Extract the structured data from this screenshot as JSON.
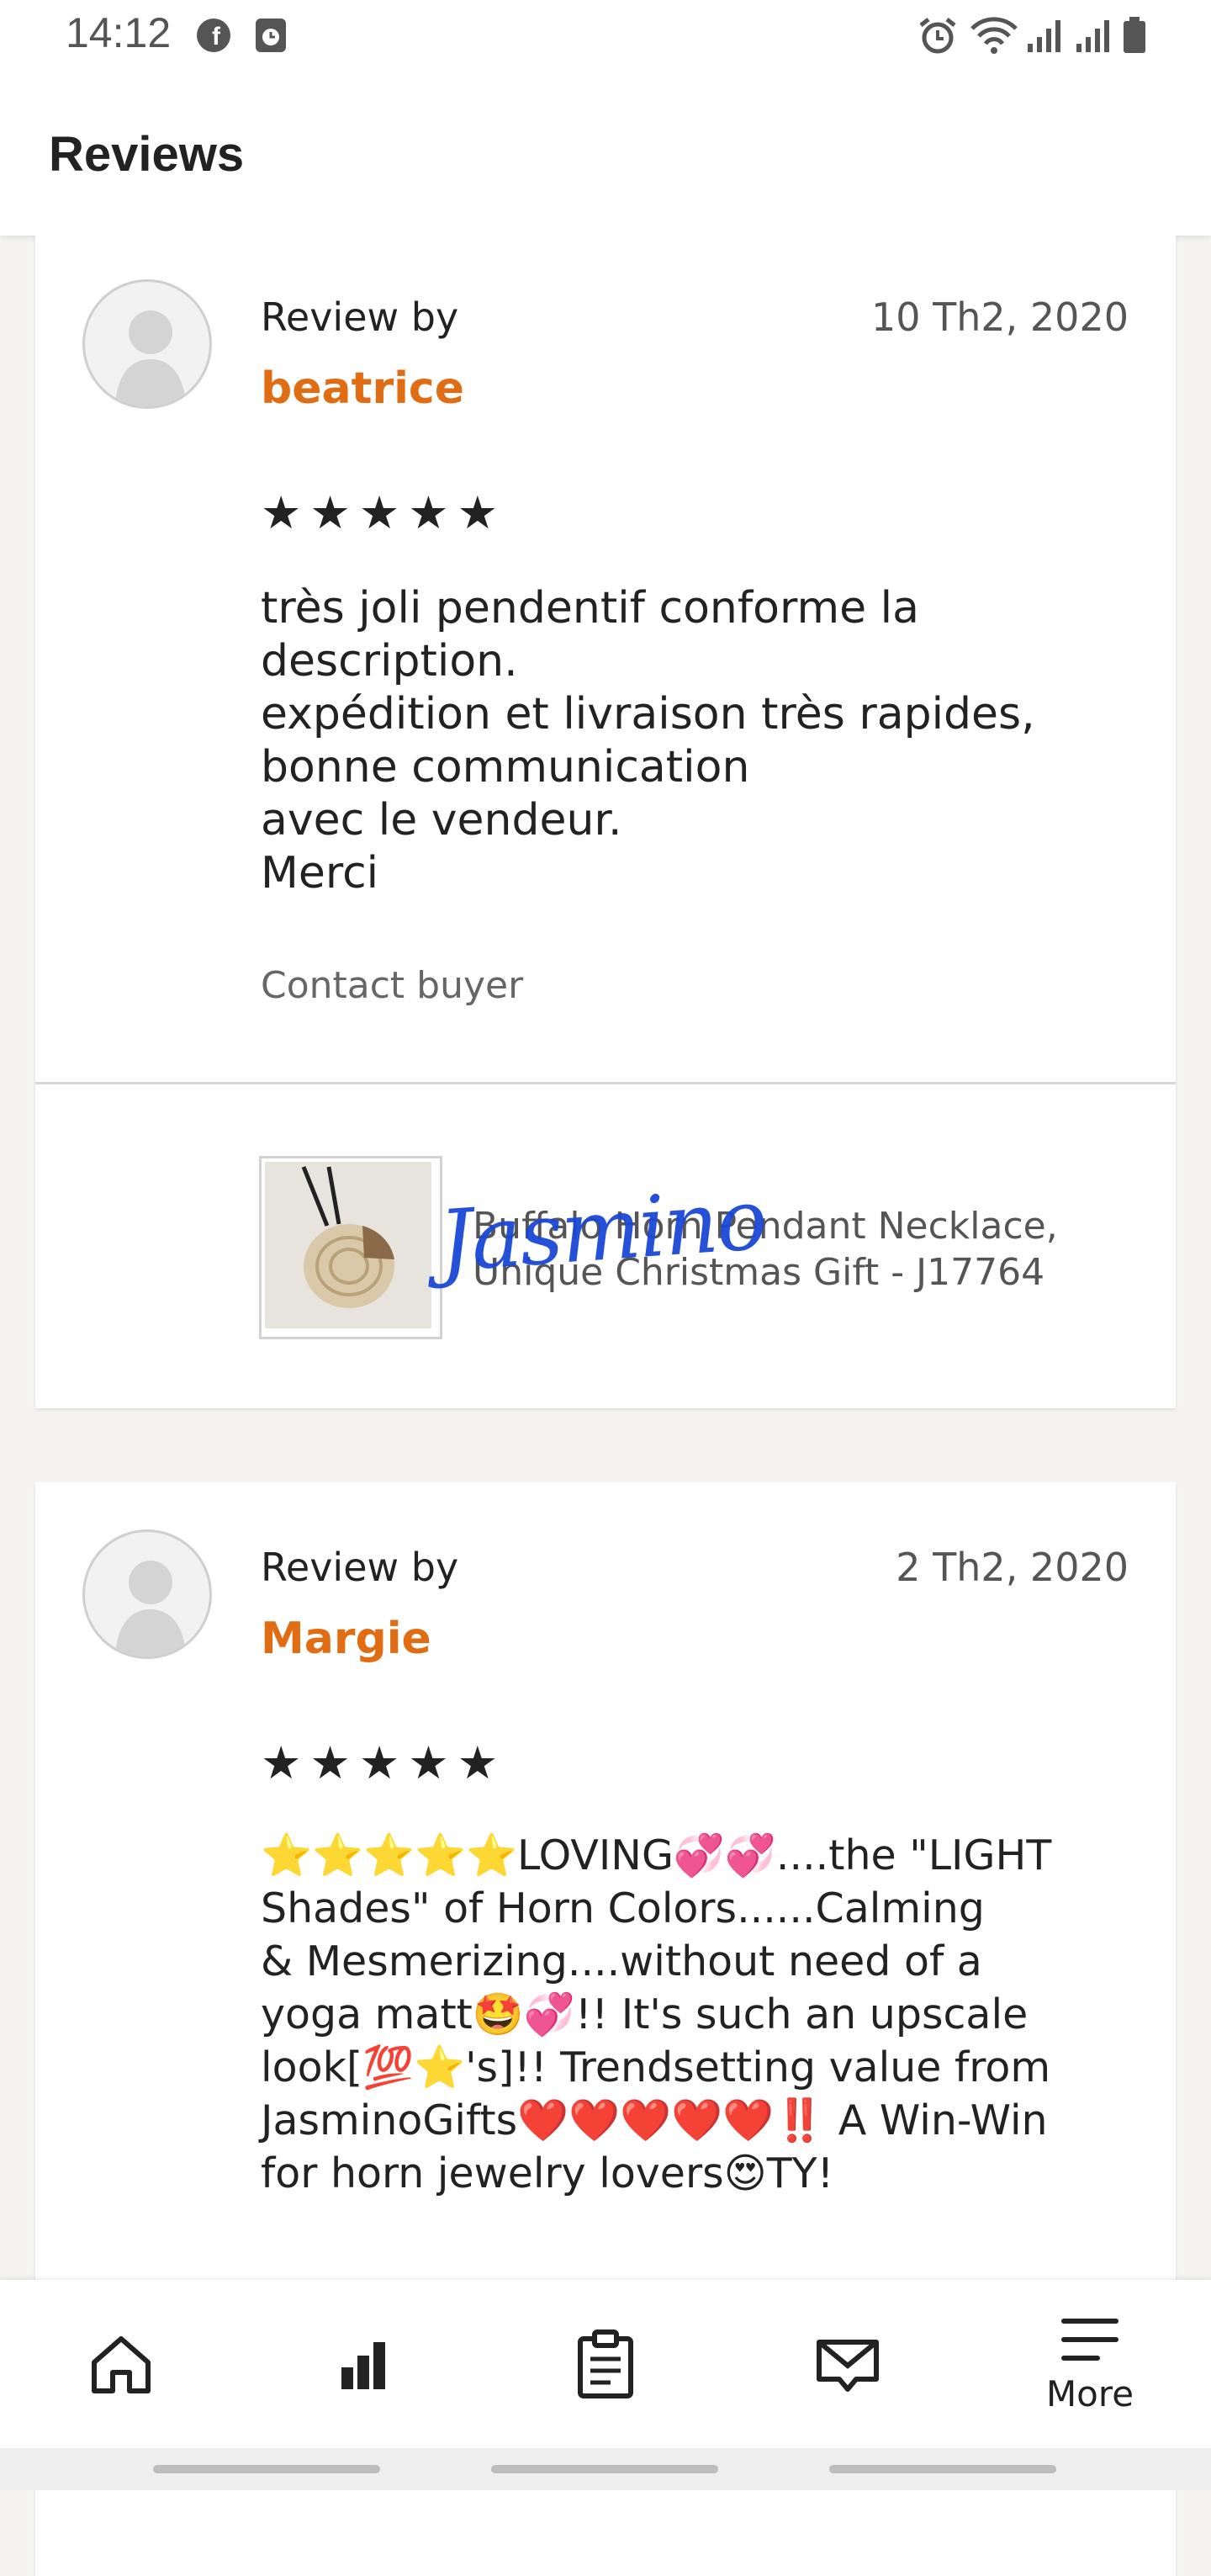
{
  "status_bar": {
    "time": "14:12",
    "left_icons": [
      "facebook-icon",
      "clock-app-icon"
    ],
    "right_icons": [
      "alarm-icon",
      "wifi-icon",
      "signal-icon",
      "signal-icon",
      "battery-icon"
    ]
  },
  "header": {
    "title": "Reviews"
  },
  "reviews": [
    {
      "review_by_label": "Review by",
      "reviewer": "beatrice",
      "date": "10 Th2, 2020",
      "stars": "★★★★★",
      "rating": 5,
      "text": "très joli pendentif conforme la\ndescription.\nexpédition et livraison très rapides,\nbonne communication\navec le vendeur.\nMerci",
      "contact_label": "Contact buyer",
      "product": {
        "name": "Buffalo Horn Pendant Necklace, Unique Christmas Gift - J17764",
        "signature": "Jasmino"
      }
    },
    {
      "review_by_label": "Review by",
      "reviewer": "Margie",
      "date": "2 Th2, 2020",
      "stars": "★★★★★",
      "rating": 5,
      "text": "⭐⭐⭐⭐⭐LOVING💞💞....the \"LIGHT\nShades\" of Horn Colors......Calming\n& Mesmerizing....without need of a\nyoga matt🤩💞!! It's such an upscale\nlook[💯⭐'s]!! Trendsetting value from\nJasminoGifts❤️❤️❤️❤️❤️‼️ A Win-Win\nfor horn jewelry lovers😍TY!"
    }
  ],
  "bottom_nav": {
    "items": [
      {
        "icon": "home-icon"
      },
      {
        "icon": "stats-icon"
      },
      {
        "icon": "orders-icon"
      },
      {
        "icon": "messages-icon"
      },
      {
        "icon": "menu-icon",
        "label": "More"
      }
    ]
  },
  "colors": {
    "accent": "#e06d13",
    "text": "#222222",
    "muted": "#666666",
    "background": "#f5f4f1"
  }
}
